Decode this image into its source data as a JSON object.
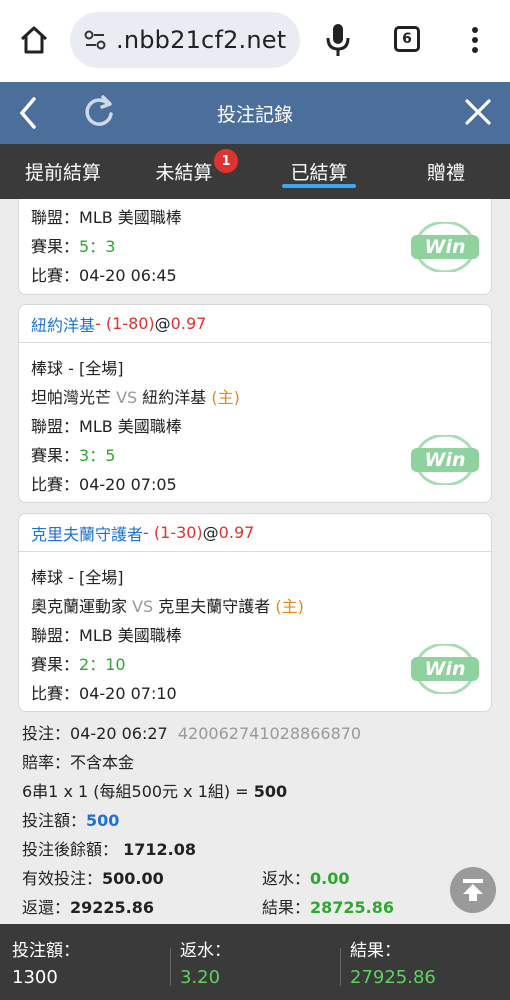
{
  "browser": {
    "url": ".nbb21cf2.net",
    "tab_count": "6"
  },
  "app": {
    "title": "投注記錄"
  },
  "tabs": [
    {
      "label": "提前結算"
    },
    {
      "label": "未結算",
      "badge": "1"
    },
    {
      "label": "已結算"
    },
    {
      "label": "贈禮"
    }
  ],
  "cards": [
    {
      "league_label": "聯盟：",
      "league": "MLB 美國職棒",
      "result_label": "賽果：",
      "result": "5：3",
      "match_label": "比賽：",
      "match_time": "04-20 06:45",
      "win": "Win"
    },
    {
      "pick_team": "紐約洋基",
      "pick_handicap": " - (1-80)",
      "pick_at": " @ ",
      "pick_odds": "0.97",
      "sport": "棒球 - [全場]",
      "home": "坦帕灣光芒",
      "vs": " VS ",
      "away": "紐約洋基",
      "host_mark": " (主)",
      "league_label": "聯盟：",
      "league": "MLB 美國職棒",
      "result_label": "賽果：",
      "result": "3：5",
      "match_label": "比賽：",
      "match_time": "04-20 07:05",
      "win": "Win"
    },
    {
      "pick_team": "克里夫蘭守護者",
      "pick_handicap": " - (1-30)",
      "pick_at": " @ ",
      "pick_odds": "0.97",
      "sport": "棒球 - [全場]",
      "home": "奧克蘭運動家",
      "vs": " VS ",
      "away": "克里夫蘭守護者",
      "host_mark": " (主)",
      "league_label": "聯盟：",
      "league": "MLB 美國職棒",
      "result_label": "賽果：",
      "result": "2：10",
      "match_label": "比賽：",
      "match_time": "04-20 07:10",
      "win": "Win"
    }
  ],
  "summary": {
    "bet_time_label": "投注：",
    "bet_time": "04-20 06:27",
    "bet_id": "420062741028866870",
    "odds_type_label": "賠率：",
    "odds_type": "不含本金",
    "combo_text": "6串1 x 1 (每組500元 x 1組) = ",
    "combo_total": "500",
    "bet_amount_label": "投注額：",
    "bet_amount": "500",
    "balance_after_label": "投注後餘額：",
    "balance_after": "1712.08",
    "valid_bet_label": "有效投注：",
    "valid_bet": "500.00",
    "rebate_label": "返水：",
    "rebate": "0.00",
    "return_label": "返還：",
    "return_amount": "29225.86",
    "result_label": "結果：",
    "result_amount": "28725.86"
  },
  "footer": {
    "bet_label": "投注額：",
    "bet_value": "1300",
    "rebate_label": "返水：",
    "rebate_value": "3.20",
    "result_label": "結果：",
    "result_value": "27925.86"
  },
  "colors": {
    "header": "#4b6f9a",
    "tabbar": "#3a3a3a",
    "accent_blue": "#1e73d2",
    "accent_red": "#e0332f",
    "accent_green": "#2ea82e",
    "host_orange": "#e88a1a",
    "win_green": "#7fcf8e"
  }
}
